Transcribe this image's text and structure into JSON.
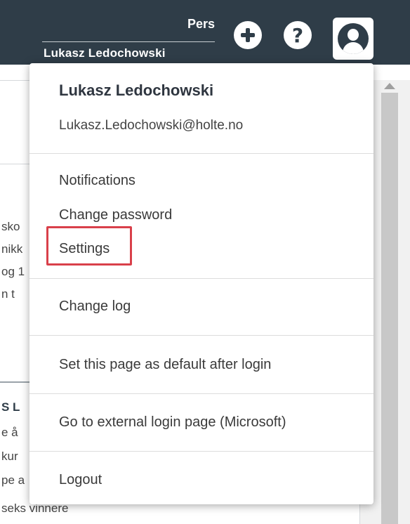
{
  "header": {
    "section_label": "Pers",
    "user_name": "Lukasz Ledochowski",
    "add_icon": "plus-circle-icon",
    "help_icon": "question-circle-icon",
    "help_glyph": "?",
    "user_icon": "user-avatar-icon",
    "bar_color": "#2f3d48"
  },
  "background_page": {
    "fragments": [
      "sko",
      "nikk",
      "og 1",
      "n t"
    ],
    "section_fragment": "S L",
    "fragments2": [
      "e å",
      "kur",
      "pe a",
      "seks vinnere"
    ]
  },
  "dropdown": {
    "user_name": "Lukasz Ledochowski",
    "user_email": "Lukasz.Ledochowski@holte.no",
    "items": [
      {
        "label": "Notifications"
      },
      {
        "label": "Change password"
      },
      {
        "label": "Settings",
        "highlighted": true
      },
      {
        "label": "Change log"
      },
      {
        "label": "Set this page as default after login"
      },
      {
        "label": "Go to external login page (Microsoft)"
      },
      {
        "label": "Logout"
      }
    ],
    "highlight_color": "#d9404a"
  }
}
